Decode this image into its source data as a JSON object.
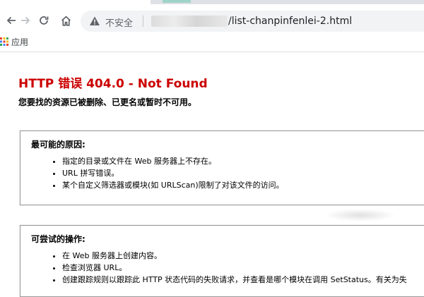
{
  "browser": {
    "address_bar": {
      "security_label": "不安全",
      "url_path": "/list-chanpinfenlei-2.html"
    },
    "bookmarks": {
      "apps_label": "应用"
    },
    "colors": {
      "chrome_tabstrip": "#dee1e6",
      "omnibox_bg": "#f1f3f4"
    }
  },
  "error_page": {
    "title": "HTTP 错误 404.0 - Not Found",
    "subtitle": "您要找的资源已被删除、已更名或暂时不可用。",
    "title_color": "#cc0000",
    "sections": [
      {
        "heading": "最可能的原因:",
        "items": [
          "指定的目录或文件在 Web 服务器上不存在。",
          "URL 拼写错误。",
          "某个自定义筛选器或模块(如 URLScan)限制了对该文件的访问。"
        ]
      },
      {
        "heading": "可尝试的操作:",
        "items": [
          "在 Web 服务器上创建内容。",
          "检查浏览器 URL。",
          "创建跟踪规则以跟踪此 HTTP 状态代码的失败请求，并查看是哪个模块在调用 SetStatus。有关为失"
        ]
      }
    ]
  }
}
